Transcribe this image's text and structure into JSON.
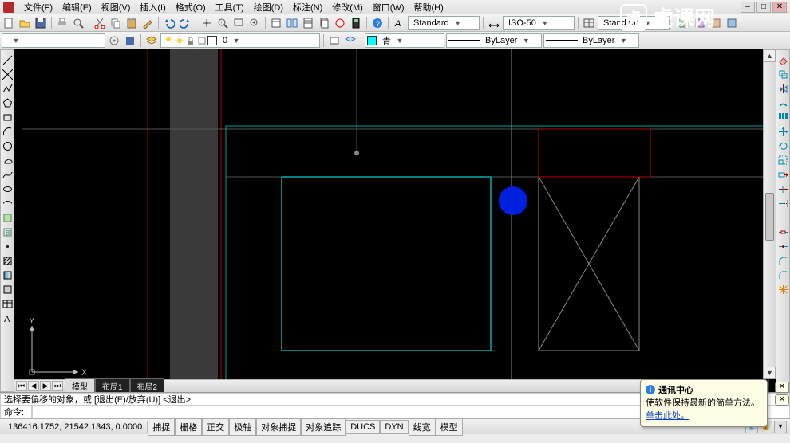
{
  "menu": {
    "items": [
      "文件(F)",
      "编辑(E)",
      "视图(V)",
      "插入(I)",
      "格式(O)",
      "工具(T)",
      "绘图(D)",
      "标注(N)",
      "修改(M)",
      "窗口(W)",
      "帮助(H)"
    ]
  },
  "toolbar1": {
    "style_a": "Standard",
    "style_b": "ISO-50",
    "style_c": "Standard"
  },
  "layerbar": {
    "layer_name": "",
    "color_name": "青",
    "linetype": "ByLayer",
    "lineweight": "ByLayer"
  },
  "popup": {
    "title": "通讯中心",
    "body": "使软件保持最新的简单方法。",
    "link": "单击此处。"
  },
  "command": {
    "history": "选择要偏移的对象，或 [退出(E)/放弃(U)] <退出>:",
    "prompt": "命令:"
  },
  "status": {
    "coords": "136416.1752, 21542.1343, 0.0000",
    "toggles": [
      "捕捉",
      "栅格",
      "正交",
      "极轴",
      "对象捕捉",
      "对象追踪",
      "DUCS",
      "DYN",
      "线宽",
      "模型"
    ]
  },
  "tabs": {
    "model": "模型",
    "layout1": "布局1",
    "layout2": "布局2"
  },
  "ucs": {
    "x": "X",
    "y": "Y"
  },
  "watermark": "虎课网"
}
